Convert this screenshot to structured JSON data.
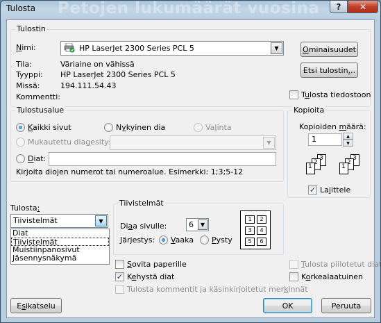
{
  "window": {
    "title": "Tulosta",
    "background_title": "Petojen lukumäärät vuosina",
    "help_label": "?",
    "close_label": "✕"
  },
  "printer": {
    "group_title": "Tulostin",
    "name_label_accel": "N",
    "name_label_rest": "imi:",
    "name_value": "HP LaserJet 2300 Series PCL 5",
    "status_label": "Tila:",
    "status_value": "Väriaine on vähissä",
    "type_label": "Tyyppi:",
    "type_value": "HP LaserJet 2300 Series PCL 5",
    "where_label": "Missä:",
    "where_value": "194.111.54.43",
    "comment_label": "Kommentti:",
    "properties_prefix": "",
    "properties_accel": "O",
    "properties_suffix": "minaisuudet",
    "find_prefix": "Etsi tulostin",
    "find_accel": ".",
    "find_suffix": "..",
    "to_file_prefix": "T",
    "to_file_accel": "u",
    "to_file_suffix": "losta tiedostoon",
    "to_file_checked": false
  },
  "range": {
    "group_title": "Tulostusalue",
    "all_accel": "K",
    "all_rest": "aikki sivut",
    "current_prefix": "N",
    "current_accel": "y",
    "current_suffix": "kyinen dia",
    "selection_prefix": "Va",
    "selection_accel": "l",
    "selection_suffix": "inta",
    "custom_prefix": "Mukautettu dia",
    "custom_accel": "g",
    "custom_suffix": "esitys:",
    "slides_accel": "D",
    "slides_rest": "iat:",
    "hint": "Kirjoita diojen numerot tai numeroalue. Esimerkki: 1;3;5-12",
    "selected": "all"
  },
  "copies": {
    "group_title": "Kopioita",
    "count_prefix": "Kopioiden ",
    "count_accel": "m",
    "count_suffix": "äärä:",
    "count_value": "1",
    "collate_prefix": "La",
    "collate_accel": "j",
    "collate_suffix": "ittele",
    "collate_checked": true,
    "stack_pages": [
      "1",
      "2",
      "3"
    ]
  },
  "print_what": {
    "label_prefix": "Tulosta",
    "label_accel": ":",
    "value": "Tiivistelmät",
    "options": [
      "Diat",
      "Tiivistelmät",
      "Muistiinpanosivut",
      "Jäsennysnäkymä"
    ],
    "selected_index": 1
  },
  "handouts": {
    "group_title": "Tiivistelmät",
    "per_page_prefix": "Di",
    "per_page_accel": "a",
    "per_page_suffix": "a sivulle:",
    "per_page_value": "6",
    "order_label": "Järjestys:",
    "horizontal_accel": "V",
    "horizontal_rest": "aaka",
    "vertical_accel": "P",
    "vertical_rest": "ysty",
    "order_selected": "horizontal",
    "preview_numbers": [
      "1",
      "2",
      "3",
      "4",
      "5",
      "6"
    ]
  },
  "options": {
    "fit_accel": "S",
    "fit_rest": "ovita paperille",
    "fit_checked": false,
    "frame_prefix": "K",
    "frame_accel": "e",
    "frame_suffix": "hystä diat",
    "frame_checked": true,
    "comments_prefix": "Tulosta kommentit ja käsinkirjoitetut mer",
    "comments_accel": "k",
    "comments_suffix": "innät",
    "hidden_accel": "T",
    "hidden_rest": "ulosta piilotetut diat",
    "high_quality_prefix": "K",
    "high_quality_accel": "o",
    "high_quality_suffix": "rkealaatuinen"
  },
  "footer": {
    "preview_prefix": "E",
    "preview_accel": "s",
    "preview_suffix": "ikatselu",
    "ok_label": "OK",
    "cancel_label": "Peruuta"
  },
  "colors": {
    "title_gradient_top": "#a9c3d9",
    "close_button": "#c3402b",
    "dialog_bg": "#f0f0f0",
    "accent_radio": "#0a58b0"
  },
  "icons": {
    "printer": "printer-icon",
    "dropdown": "chevron-down-icon",
    "collate_stacks": "collate-pages-icon"
  }
}
